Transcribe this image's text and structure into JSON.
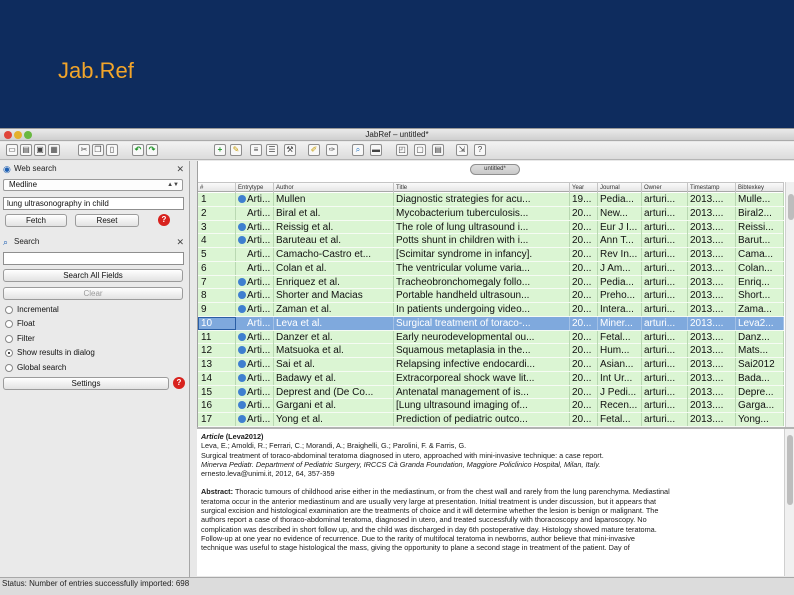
{
  "slide": {
    "title": "Jab.Ref"
  },
  "window": {
    "title": "JabRef – untitled*"
  },
  "web_search": {
    "header": "Web search",
    "database": "Medline",
    "query": "lung ultrasonography in child",
    "fetch_label": "Fetch",
    "reset_label": "Reset"
  },
  "search": {
    "header": "Search",
    "query": "",
    "search_all_label": "Search All Fields",
    "clear_label": "Clear",
    "options": [
      {
        "label": "Incremental",
        "checked": false
      },
      {
        "label": "Float",
        "checked": false
      },
      {
        "label": "Filter",
        "checked": false
      },
      {
        "label": "Show results in dialog",
        "checked": true
      },
      {
        "label": "Global search",
        "checked": false
      }
    ],
    "settings_label": "Settings"
  },
  "tab_label": "untitled*",
  "table": {
    "columns": [
      "#",
      "Entrytype",
      "Author",
      "Title",
      "Year",
      "Journal",
      "Owner",
      "Timestamp",
      "Bibtexkey"
    ],
    "selected_row": 10,
    "rows": [
      {
        "num": "1",
        "type": "Arti...",
        "author": "Mullen",
        "title": "Diagnostic strategies for acu...",
        "year": "19...",
        "journal": "Pedia...",
        "owner": "arturi...",
        "timestamp": "2013....",
        "key": "Mulle...",
        "web": true
      },
      {
        "num": "2",
        "type": "Arti...",
        "author": "Biral et al.",
        "title": "Mycobacterium tuberculosis...",
        "year": "20...",
        "journal": "New...",
        "owner": "arturi...",
        "timestamp": "2013....",
        "key": "Biral2...",
        "web": false
      },
      {
        "num": "3",
        "type": "Arti...",
        "author": "Reissig et al.",
        "title": "The role of lung ultrasound i...",
        "year": "20...",
        "journal": "Eur J I...",
        "owner": "arturi...",
        "timestamp": "2013....",
        "key": "Reissi...",
        "web": true
      },
      {
        "num": "4",
        "type": "Arti...",
        "author": "Baruteau et al.",
        "title": "Potts shunt in children with i...",
        "year": "20...",
        "journal": "Ann T...",
        "owner": "arturi...",
        "timestamp": "2013....",
        "key": "Barut...",
        "web": true
      },
      {
        "num": "5",
        "type": "Arti...",
        "author": "Camacho-Castro et...",
        "title": "[Scimitar syndrome in infancy].",
        "year": "20...",
        "journal": "Rev In...",
        "owner": "arturi...",
        "timestamp": "2013....",
        "key": "Cama...",
        "web": false
      },
      {
        "num": "6",
        "type": "Arti...",
        "author": "Colan et al.",
        "title": "The ventricular volume varia...",
        "year": "20...",
        "journal": "J Am...",
        "owner": "arturi...",
        "timestamp": "2013....",
        "key": "Colan...",
        "web": false
      },
      {
        "num": "7",
        "type": "Arti...",
        "author": "Enriquez et al.",
        "title": "Tracheobronchomegaly follo...",
        "year": "20...",
        "journal": "Pedia...",
        "owner": "arturi...",
        "timestamp": "2013....",
        "key": "Enriq...",
        "web": true
      },
      {
        "num": "8",
        "type": "Arti...",
        "author": "Shorter and Macias",
        "title": "Portable handheld ultrasoun...",
        "year": "20...",
        "journal": "Preho...",
        "owner": "arturi...",
        "timestamp": "2013....",
        "key": "Short...",
        "web": true
      },
      {
        "num": "9",
        "type": "Arti...",
        "author": "Zaman et al.",
        "title": "In patients undergoing video...",
        "year": "20...",
        "journal": "Intera...",
        "owner": "arturi...",
        "timestamp": "2013....",
        "key": "Zama...",
        "web": true
      },
      {
        "num": "10",
        "type": "Arti...",
        "author": "Leva et al.",
        "title": "Surgical treatment of toraco-...",
        "year": "20...",
        "journal": "Miner...",
        "owner": "arturi...",
        "timestamp": "2013....",
        "key": "Leva2...",
        "web": false
      },
      {
        "num": "11",
        "type": "Arti...",
        "author": "Danzer et al.",
        "title": "Early neurodevelopmental ou...",
        "year": "20...",
        "journal": "Fetal...",
        "owner": "arturi...",
        "timestamp": "2013....",
        "key": "Danz...",
        "web": true
      },
      {
        "num": "12",
        "type": "Arti...",
        "author": "Matsuoka et al.",
        "title": "Squamous metaplasia in the...",
        "year": "20...",
        "journal": "Hum...",
        "owner": "arturi...",
        "timestamp": "2013....",
        "key": "Mats...",
        "web": true
      },
      {
        "num": "13",
        "type": "Arti...",
        "author": "Sai et al.",
        "title": "Relapsing infective endocardi...",
        "year": "20...",
        "journal": "Asian...",
        "owner": "arturi...",
        "timestamp": "2013....",
        "key": "Sai2012",
        "web": true
      },
      {
        "num": "14",
        "type": "Arti...",
        "author": "Badawy et al.",
        "title": "Extracorporeal shock wave lit...",
        "year": "20...",
        "journal": "Int Ur...",
        "owner": "arturi...",
        "timestamp": "2013....",
        "key": "Bada...",
        "web": true
      },
      {
        "num": "15",
        "type": "Arti...",
        "author": "Deprest and (De Co...",
        "title": "Antenatal management of is...",
        "year": "20...",
        "journal": "J Pedi...",
        "owner": "arturi...",
        "timestamp": "2013....",
        "key": "Depre...",
        "web": true
      },
      {
        "num": "16",
        "type": "Arti...",
        "author": "Gargani et al.",
        "title": "[Lung ultrasound imaging of...",
        "year": "20...",
        "journal": "Recen...",
        "owner": "arturi...",
        "timestamp": "2013....",
        "key": "Garga...",
        "web": true
      },
      {
        "num": "17",
        "type": "Arti...",
        "author": "Yong et al.",
        "title": "Prediction of pediatric outco...",
        "year": "20...",
        "journal": "Fetal...",
        "owner": "arturi...",
        "timestamp": "2013....",
        "key": "Yong...",
        "web": true
      }
    ]
  },
  "preview": {
    "entry_type": "Article",
    "key": "(Leva2012)",
    "authors": "Leva, E.; Amoldi, R.; Ferrari, C.; Morandi, A.; Braighelli, G.; Parolini, F. & Farris, G.",
    "title": "Surgical treatment of toraco-abdominal teratoma diagnosed in utero, approached with mini-invasive technique: a case report.",
    "affiliation": "Minerva Pediatr. Department of Pediatric Surgery, IRCCS Cà Granda Foundation, Maggiore Policlinico Hospital, Milan, Italy.",
    "citation": "ernesto.leva@unimi.it, 2012, 64, 357-359",
    "abstract_label": "Abstract:",
    "abstract_lines": [
      "Thoracic tumours of childhood arise either in the mediastinum, or from the chest wall and rarely from the lung parenchyma. Mediastinal",
      "teratoma occur in the anterior mediastinum and are usually very large at presentation. Initial treatment is under discussion, but it appears that",
      "surgical excision and histological examination are the treatments of choice and it will determine whether the lesion is benign or malignant. The",
      "authors report a case of thoraco-abdominal teratoma, diagnosed in utero, and treated successfully with thoracoscopy and laparoscopy. No",
      "complication was described in short follow up, and the child was discharged in day 6th postoperative day. Histology showed mature teratoma.",
      "Follow-up at one year no evidence of recurrence. Due to the rarity of multifocal teratoma in newborns, author believe that mini-invasive",
      "technique was useful to stage histological the mass, giving the opportunity to plane a second stage in treatment of the patient. Day of"
    ]
  },
  "status": {
    "text": "Status: Number of entries successfully imported: 698"
  }
}
